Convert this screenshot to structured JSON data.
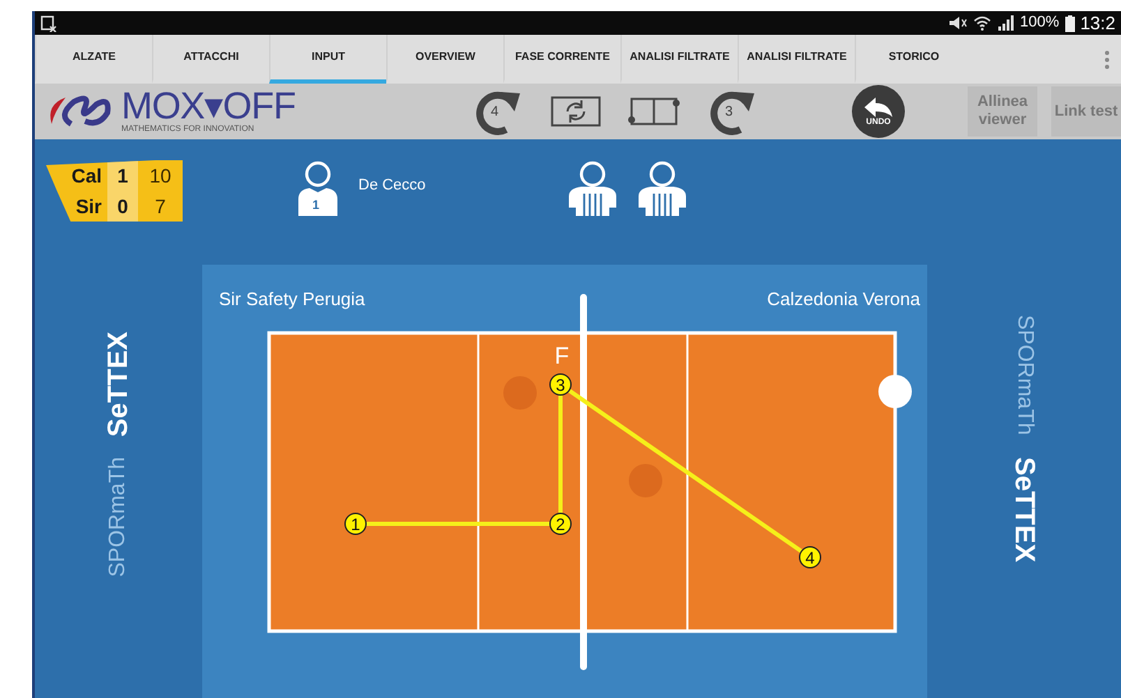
{
  "status_bar": {
    "battery": "100%",
    "time": "13:2"
  },
  "tabs": [
    {
      "label": "ALZATE",
      "selected": false
    },
    {
      "label": "ATTACCHI",
      "selected": false
    },
    {
      "label": "INPUT",
      "selected": true
    },
    {
      "label": "OVERVIEW",
      "selected": false
    },
    {
      "label": "FASE CORRENTE",
      "selected": false
    },
    {
      "label": "ANALISI FILTRATE",
      "selected": false
    },
    {
      "label": "ANALISI FILTRATE",
      "selected": false
    },
    {
      "label": "STORICO",
      "selected": false
    }
  ],
  "toolbar": {
    "logo": {
      "name": "MOX▾OFF",
      "tagline": "MATHEMATICS FOR INNOVATION"
    },
    "tools": [
      {
        "kind": "rotate-back",
        "label": "4"
      },
      {
        "kind": "swap"
      },
      {
        "kind": "court"
      },
      {
        "kind": "rotate-forward",
        "label": "3"
      },
      {
        "kind": "undo",
        "label": "UNDO"
      }
    ],
    "buttons": [
      "Allinea viewer",
      "Link test"
    ]
  },
  "scoreboard": [
    {
      "team": "Cal",
      "sets": "1",
      "points": "10"
    },
    {
      "team": "Sir",
      "sets": "0",
      "points": "7"
    }
  ],
  "setter": {
    "number": "1",
    "name": "De Cecco"
  },
  "branding_left": {
    "brand": "SeTTEX",
    "sub": "SPORmaTh"
  },
  "branding_right": {
    "sub": "SPORmaTh",
    "brand": "SeTTEX"
  },
  "court": {
    "team_left": "Sir Safety Perugia",
    "team_right": "Calzedonia Verona",
    "net_label": "F",
    "points": [
      {
        "label": "1"
      },
      {
        "label": "2"
      },
      {
        "label": "3"
      },
      {
        "label": "4"
      }
    ]
  }
}
